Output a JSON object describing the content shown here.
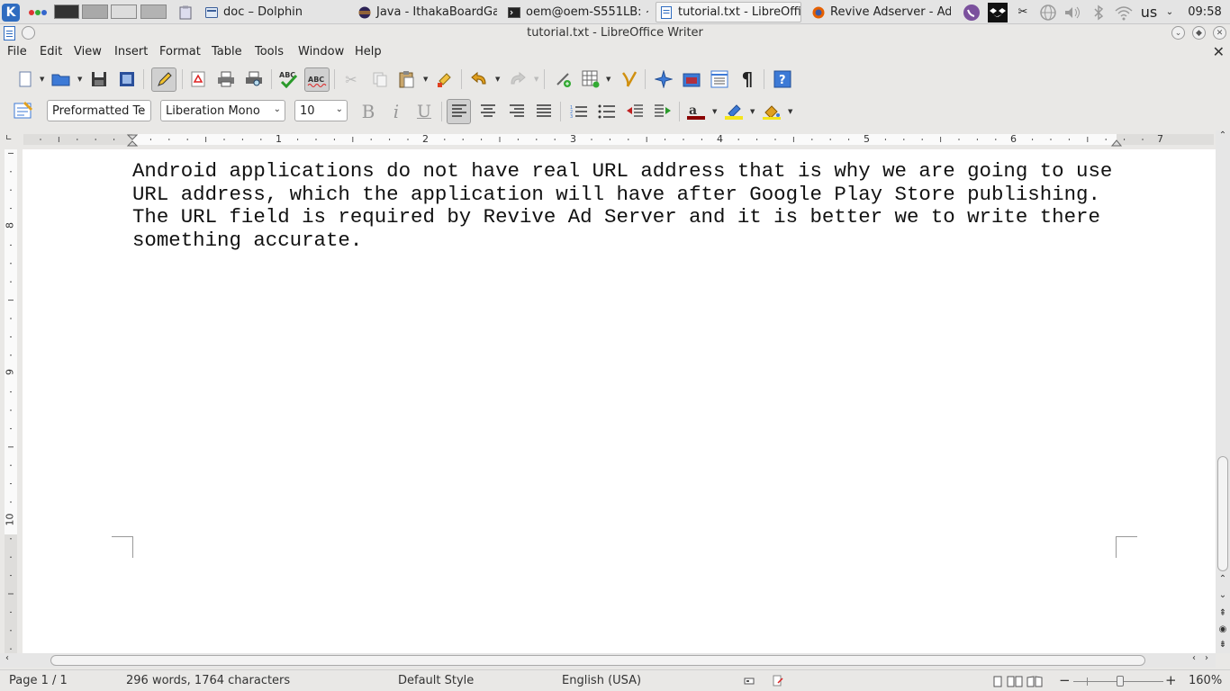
{
  "taskbar": {
    "tasks": [
      {
        "label": "doc – Dolphin"
      },
      {
        "label": "Java - IthakaBoardGam"
      },
      {
        "label": "oem@oem-S551LB: ~/t"
      },
      {
        "label": "tutorial.txt - LibreOffic"
      },
      {
        "label": "Revive Adserver - Add"
      }
    ],
    "keyboard_layout": "us",
    "clock": "09:58"
  },
  "window": {
    "title": "tutorial.txt - LibreOffice Writer"
  },
  "menubar": {
    "items": [
      "File",
      "Edit",
      "View",
      "Insert",
      "Format",
      "Table",
      "Tools",
      "Window",
      "Help"
    ]
  },
  "formatting": {
    "paragraph_style": "Preformatted Te",
    "font_name": "Liberation Mono",
    "font_size": "10"
  },
  "ruler": {
    "h_numbers": [
      "1",
      "2",
      "3",
      "4",
      "5",
      "6",
      "7"
    ],
    "v_numbers": [
      "8",
      "9",
      "10"
    ]
  },
  "document": {
    "text": "Android applications do not have real URL address that is why we are going to use URL address, which the application will have after Google Play Store publishing. The URL field is required by Revive Ad Server and it is better we to write there something accurate."
  },
  "statusbar": {
    "page": "Page 1 / 1",
    "word_count": "296 words, 1764 characters",
    "page_style": "Default Style",
    "language": "English (USA)",
    "zoom": "160%"
  },
  "colors": {
    "accent": "#2f6cc0",
    "page": "#ffffff",
    "chrome": "#e9e8e6"
  }
}
